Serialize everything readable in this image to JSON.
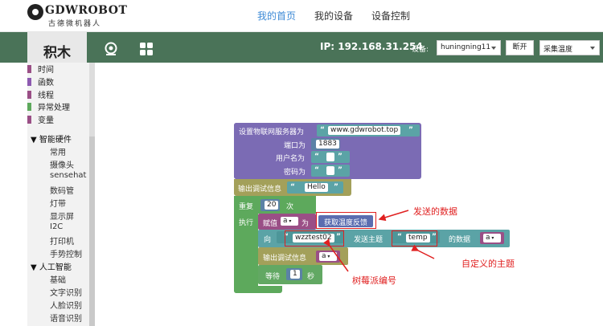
{
  "header": {
    "logo_text": "GDWROBOT",
    "logo_sub": "古德微机器人",
    "nav": [
      {
        "label": "我的首页",
        "active": true
      },
      {
        "label": "我的设备",
        "active": false
      },
      {
        "label": "设备控制",
        "active": false
      }
    ]
  },
  "toolbar": {
    "panel_title": "积木",
    "ip_text": "IP: 192.168.31.254",
    "device_label": "设备:",
    "device_select": "huningning11",
    "disconnect_button": "断开",
    "mode_select": "采集温度",
    "accent_color": "#4a7358"
  },
  "sidebar": {
    "categories": [
      {
        "label": "时间",
        "color": "#9a4f86"
      },
      {
        "label": "函数",
        "color": "#8d5ab0"
      },
      {
        "label": "线程",
        "color": "#9a4f86"
      },
      {
        "label": "异常处理",
        "color": "#5da95c"
      },
      {
        "label": "变量",
        "color": "#9a4f86"
      }
    ],
    "group1": "▼ 智能硬件",
    "group1_items": [
      "常用",
      "摄像头",
      "sensehat",
      "数码管",
      "灯带",
      "显示屏",
      "I2C",
      "打印机",
      "手势控制"
    ],
    "group2": "▼ 人工智能",
    "group2_items": [
      "基础",
      "文字识别",
      "人脸识别",
      "语音识别"
    ]
  },
  "blocks": {
    "iot_server_label": "设置物联网服务器为",
    "server_value": "www.gdwrobot.top",
    "port_label": "端口为",
    "port_value": "1883",
    "user_label": "用户名为",
    "password_label": "密码为",
    "debug_label": "输出调试信息",
    "debug_value": "Hello",
    "repeat_label": "重复",
    "repeat_count": "20",
    "repeat_unit": "次",
    "execute_label": "执行",
    "assign_label": "赋值",
    "assign_var": "a",
    "assign_as": "为",
    "sensor_block": "获取温度反馈",
    "to_label": "向",
    "device_name": "wzztest02",
    "topic_label": "发送主题",
    "topic_value": "temp",
    "data_label": "的数据",
    "data_var": "a",
    "debug2_label": "输出调试信息",
    "debug2_var": "a",
    "wait_label": "等待",
    "wait_value": "1",
    "wait_unit": "秒"
  },
  "annotations": {
    "sent_data": "发送的数据",
    "custom_topic": "自定义的主题",
    "pi_id": "树莓派编号"
  }
}
